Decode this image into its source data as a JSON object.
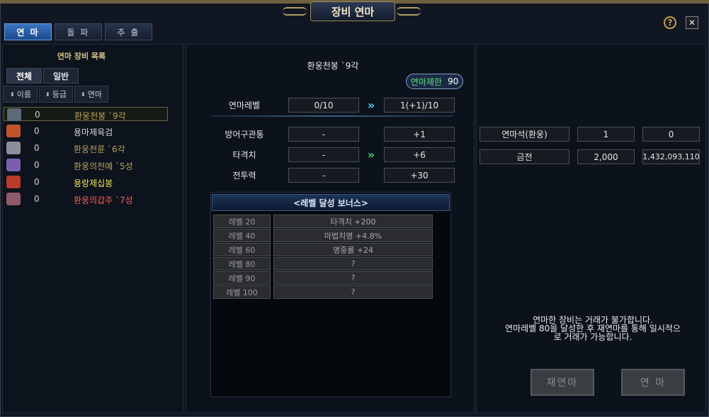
{
  "window": {
    "title": "장비 연마"
  },
  "tabs": [
    "연 마",
    "돌 파",
    "추 출"
  ],
  "left": {
    "title": "연마 장비 목록",
    "filters": [
      "전체",
      "일반"
    ],
    "sorts": [
      "이름",
      "등급",
      "연마"
    ],
    "items": [
      {
        "count": "0",
        "name": "환웅천봉 `9각",
        "color": "#b9a25b",
        "icon": "sword-icon",
        "iconColor": "#5d6a78"
      },
      {
        "count": "0",
        "name": "용마제육검",
        "color": "#d8d8d8",
        "icon": "blade-icon",
        "iconColor": "#c0542a"
      },
      {
        "count": "0",
        "name": "환웅천륜 `6각",
        "color": "#b9a25b",
        "icon": "ring-icon",
        "iconColor": "#8a8f99"
      },
      {
        "count": "0",
        "name": "환웅의천예 `5성",
        "color": "#b9a25b",
        "icon": "armor-icon",
        "iconColor": "#7a5fb0"
      },
      {
        "count": "0",
        "name": "용랑제십봉",
        "color": "#f2e55a",
        "icon": "staff-icon",
        "iconColor": "#b83a2a"
      },
      {
        "count": "0",
        "name": "환웅의갑주 `7성",
        "color": "#ff5a5a",
        "icon": "helm-icon",
        "iconColor": "#8e5a6a"
      }
    ]
  },
  "mid": {
    "item_name": "환웅천봉 `9각",
    "limit_label": "연마제한",
    "limit_value": "90",
    "level_label": "연마레벨",
    "level_current": "0/10",
    "level_next": "1(+1)/10",
    "stats": [
      {
        "label": "방어구관통",
        "current": "-",
        "next": "+1"
      },
      {
        "label": "타격치",
        "current": "-",
        "next": "+6"
      },
      {
        "label": "전투력",
        "current": "-",
        "next": "+30"
      }
    ],
    "bonus_title": "<레벨 달성 보너스>",
    "bonuses": [
      {
        "level": "레벨 20",
        "value": "타격치 +200"
      },
      {
        "level": "레벨 40",
        "value": "마법치명 +4.8%"
      },
      {
        "level": "레벨 60",
        "value": "명중률 +24"
      },
      {
        "level": "레벨 80",
        "value": "?"
      },
      {
        "level": "레벨 90",
        "value": "?"
      },
      {
        "level": "레벨 100",
        "value": "?"
      }
    ]
  },
  "right": {
    "materials": [
      {
        "name": "연마석(환웅)",
        "required": "1",
        "owned": "0"
      },
      {
        "name": "금전",
        "required": "2,000",
        "owned": "1,432,093,110"
      }
    ],
    "notice": [
      "연마한 장비는 거래가 불가합니다.",
      "연마레벨 80을 달성한 후 재연마를 통해 일시적으",
      "로 거래가 가능합니다."
    ],
    "buttons": {
      "reroll": "재연마",
      "refine": "연 마"
    }
  },
  "icons": {
    "help": "?",
    "close": "✕",
    "arrow": "»"
  }
}
